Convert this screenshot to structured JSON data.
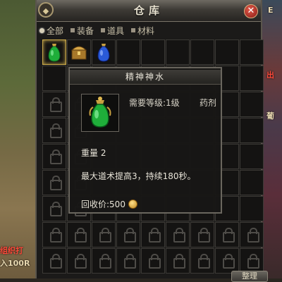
{
  "window": {
    "title": "仓库",
    "close_label": "✕"
  },
  "tabs": [
    {
      "label": "全部",
      "active": true
    },
    {
      "label": "装备",
      "active": false
    },
    {
      "label": "道具",
      "active": false
    },
    {
      "label": "材料",
      "active": false
    }
  ],
  "items": [
    {
      "icon": "green-potion-icon",
      "selected": true
    },
    {
      "icon": "treasure-chest-icon",
      "selected": false
    },
    {
      "icon": "blue-potion-icon",
      "selected": false
    }
  ],
  "tooltip": {
    "name": "精神神水",
    "level_req": "需要等级:1级",
    "item_type": "药剂",
    "weight": "重量 2",
    "description": "最大道术提高3，持续180秒。",
    "sell_price": "回收价:500"
  },
  "side_texts": {
    "left_line1": "组织打",
    "left_line2": "入100R",
    "right_line1": "E",
    "right_line2": "出",
    "right_line3": "葡"
  },
  "bottom_button": "整理",
  "colors": {
    "accent": "#c9a94a",
    "close": "#c0392b",
    "coin": "#e0a830"
  }
}
